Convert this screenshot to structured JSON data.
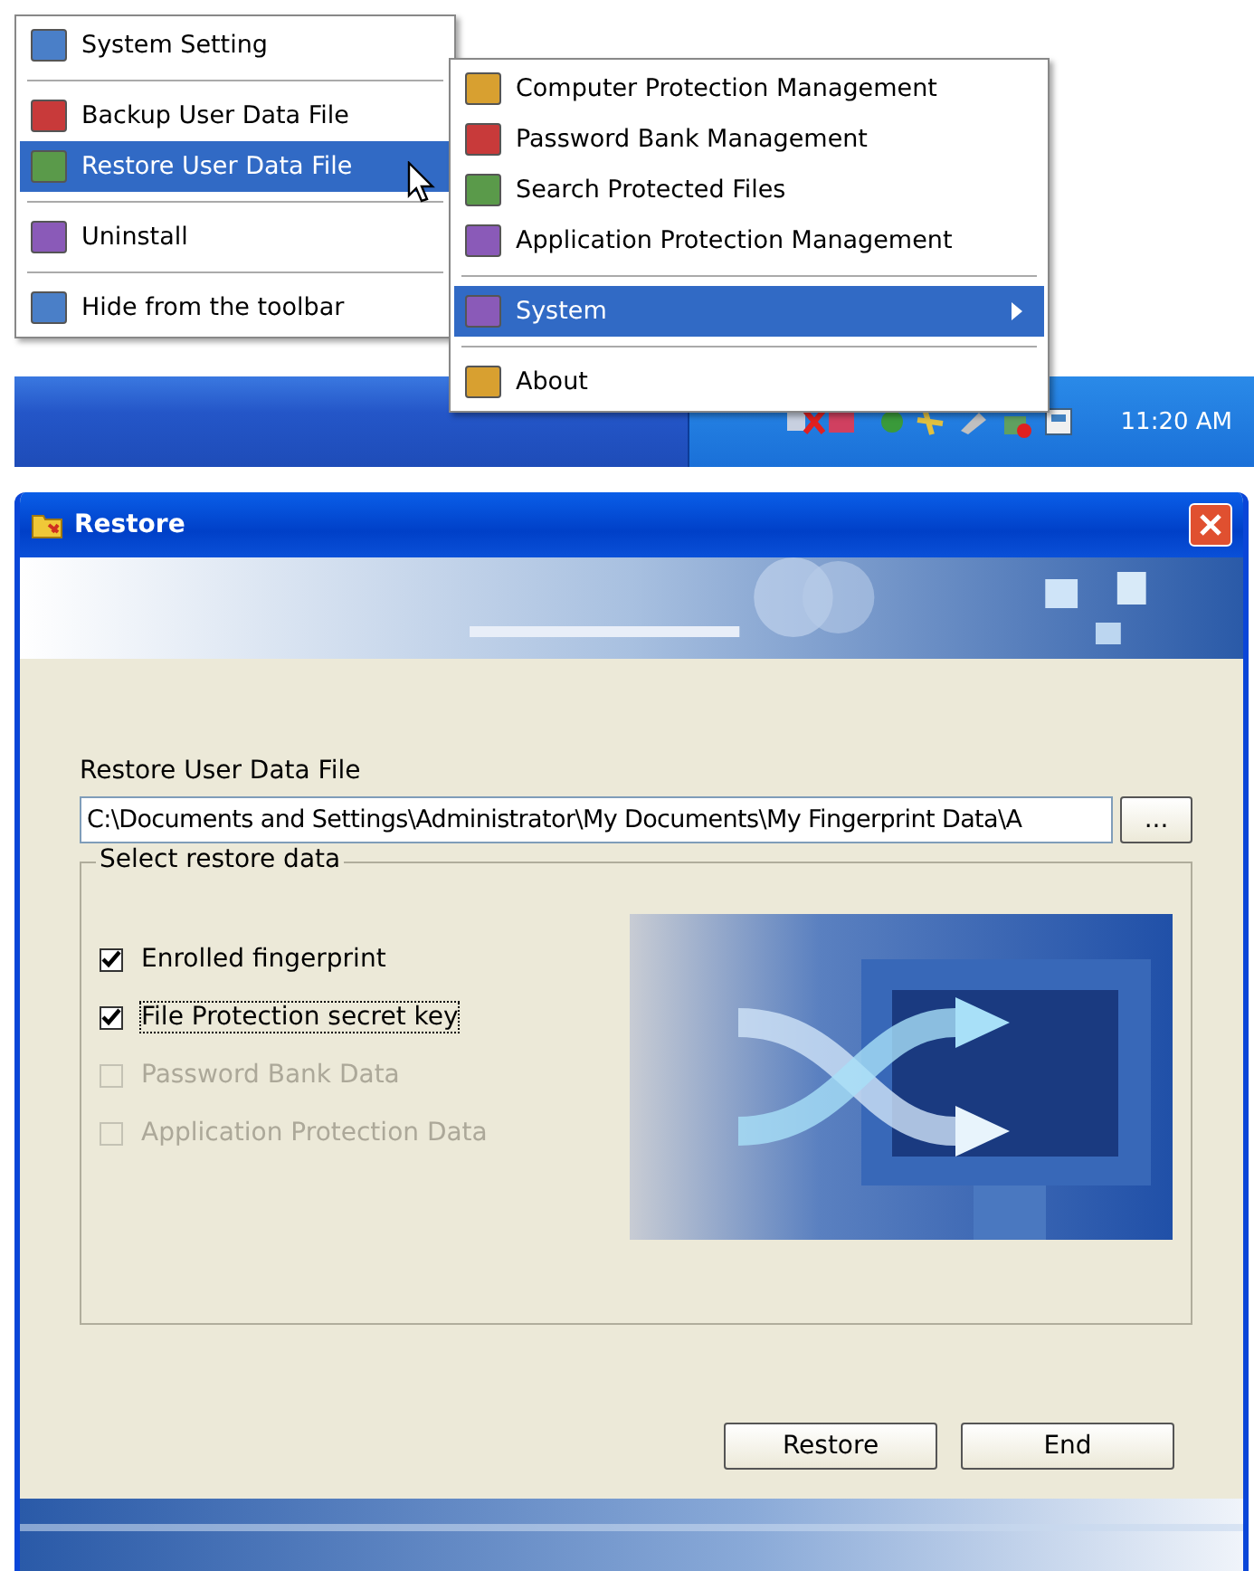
{
  "tray_menu": {
    "groups": [
      [
        {
          "label": "System Setting",
          "selected": false
        }
      ],
      [
        {
          "label": "Backup User Data File",
          "selected": false
        },
        {
          "label": "Restore User Data File",
          "selected": true
        }
      ],
      [
        {
          "label": "Uninstall",
          "selected": false
        }
      ],
      [
        {
          "label": "Hide from the toolbar",
          "selected": false
        }
      ]
    ]
  },
  "submenu": {
    "groups": [
      [
        {
          "label": "Computer Protection Management",
          "selected": false,
          "kind": "item"
        },
        {
          "label": "Password Bank Management",
          "selected": false,
          "kind": "item"
        },
        {
          "label": "Search Protected Files",
          "selected": false,
          "kind": "item"
        },
        {
          "label": "Application Protection Management",
          "selected": false,
          "kind": "item"
        }
      ],
      [
        {
          "label": "System",
          "selected": true,
          "kind": "submenu"
        }
      ],
      [
        {
          "label": "About",
          "selected": false,
          "kind": "item"
        }
      ]
    ]
  },
  "taskbar": {
    "clock": "11:20 AM"
  },
  "dialog": {
    "title": "Restore",
    "file_label": "Restore User Data File",
    "file_path": "C:\\Documents and Settings\\Administrator\\My Documents\\My Fingerprint Data\\A",
    "browse_button": "...",
    "group_title": "Select restore data",
    "options": [
      {
        "label": "Enrolled fingerprint",
        "checked": true,
        "disabled": false,
        "focused": false
      },
      {
        "label": "File Protection secret key",
        "checked": true,
        "disabled": false,
        "focused": true
      },
      {
        "label": "Password Bank Data",
        "checked": false,
        "disabled": true,
        "focused": false
      },
      {
        "label": "Application Protection Data",
        "checked": false,
        "disabled": true,
        "focused": false
      }
    ],
    "buttons": [
      "Restore",
      "End"
    ]
  }
}
